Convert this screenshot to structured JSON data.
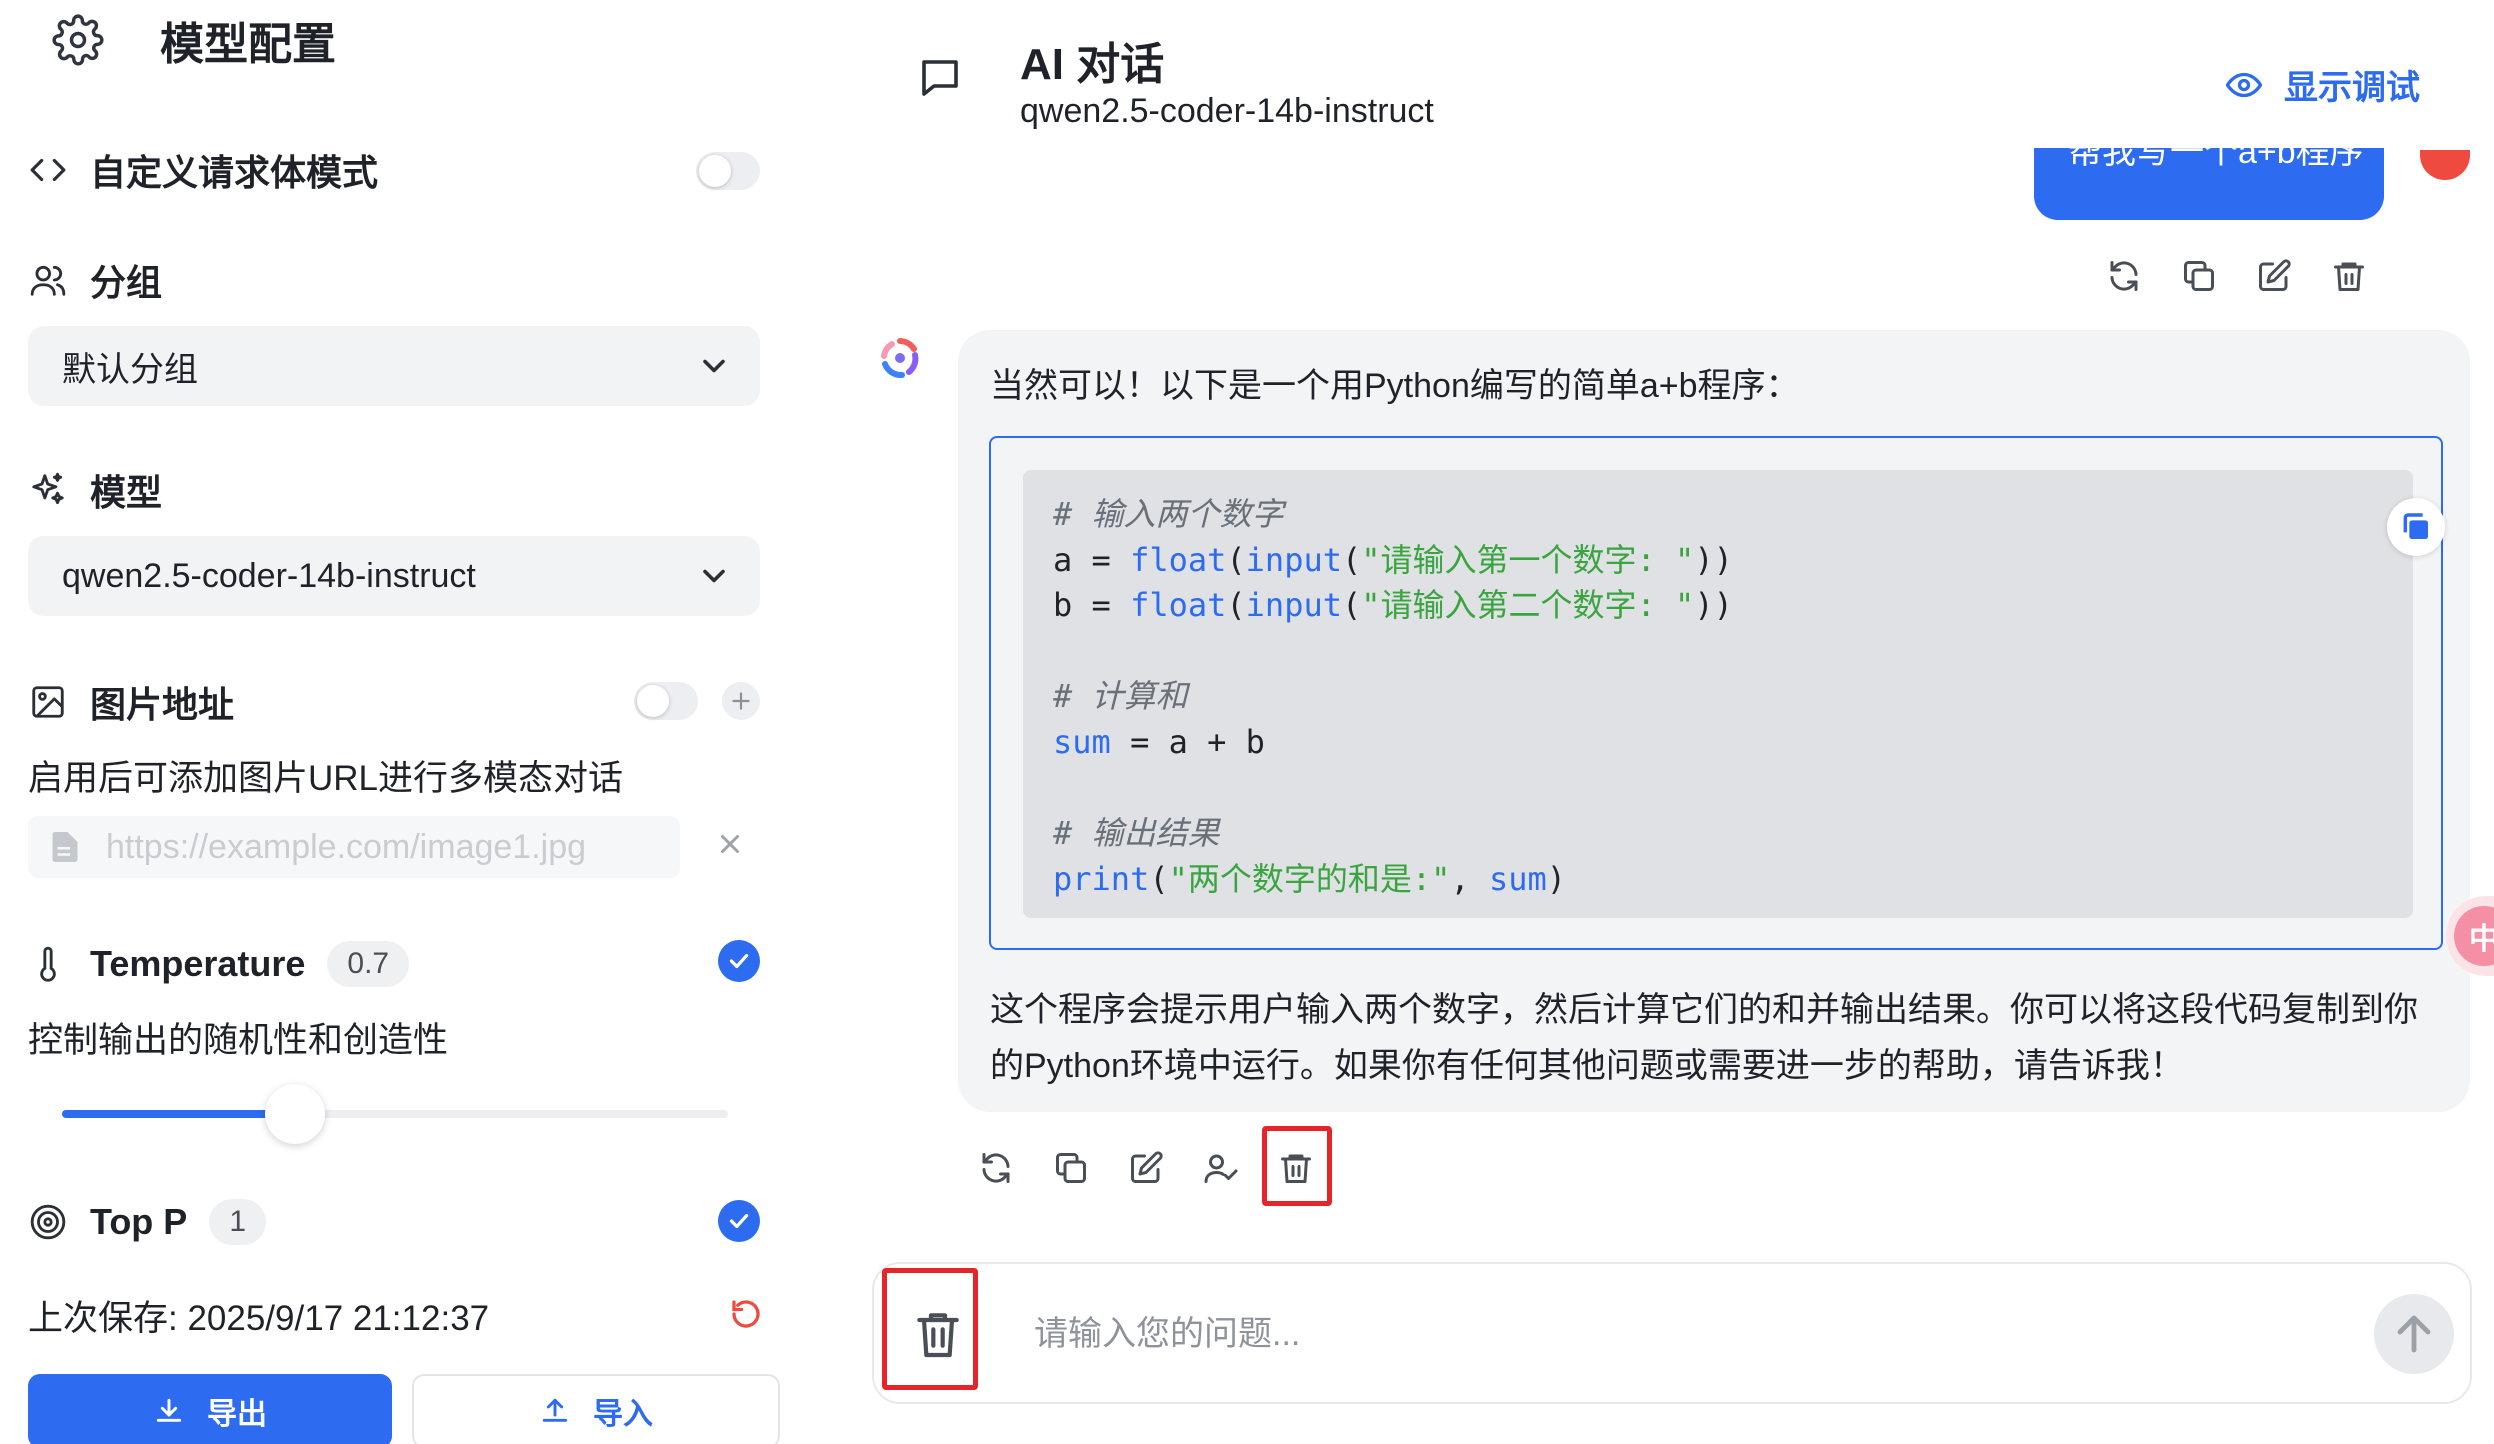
{
  "config": {
    "title": "模型配置",
    "custom_body": {
      "label": "自定义请求体模式",
      "enabled": false
    },
    "group": {
      "label": "分组",
      "selected": "默认分组"
    },
    "model": {
      "label": "模型",
      "selected": "qwen2.5-coder-14b-instruct"
    },
    "image": {
      "label": "图片地址",
      "enabled": false,
      "description": "启用后可添加图片URL进行多模态对话",
      "url_placeholder": "https://example.com/image1.jpg",
      "url_value": ""
    },
    "temperature": {
      "label": "Temperature",
      "value": "0.7",
      "enabled": true,
      "description": "控制输出的随机性和创造性",
      "slider_fraction": 0.35
    },
    "top_p": {
      "label": "Top P",
      "value": "1",
      "enabled": true
    },
    "saved": "上次保存: 2025/9/17 21:12:37",
    "export_label": "导出",
    "import_label": "导入"
  },
  "chat": {
    "title": "AI 对话",
    "model": "qwen2.5-coder-14b-instruct",
    "debug_label": "显示调试",
    "user_message": "帮我写一个a+b程序",
    "bot_intro": "当然可以！以下是一个用Python编写的简单a+b程序：",
    "bot_outro": "这个程序会提示用户输入两个数字，然后计算它们的和并输出结果。你可以将这段代码复制到你的Python环境中运行。如果你有任何其他问题或需要进一步的帮助，请告诉我！",
    "input_placeholder": "请输入您的问题...",
    "float_badge": "中"
  },
  "code": {
    "comment1": "# 输入两个数字",
    "a": "a",
    "b": "b",
    "eq": " = ",
    "float": "float",
    "input": "input",
    "prompt1": "\"请输入第一个数字: \"",
    "prompt2": "\"请输入第二个数字: \"",
    "open": "(",
    "close2": "))",
    "comment2": "# 计算和",
    "sum": "sum",
    "sum_expr": " = a + b",
    "comment3": "# 输出结果",
    "print": "print",
    "print_str": "\"两个数字的和是:\"",
    "comma": ", ",
    "close1": ")"
  },
  "colors": {
    "accent": "#2d6cf0",
    "highlight": "#e5252a",
    "string": "#3aa53f"
  }
}
